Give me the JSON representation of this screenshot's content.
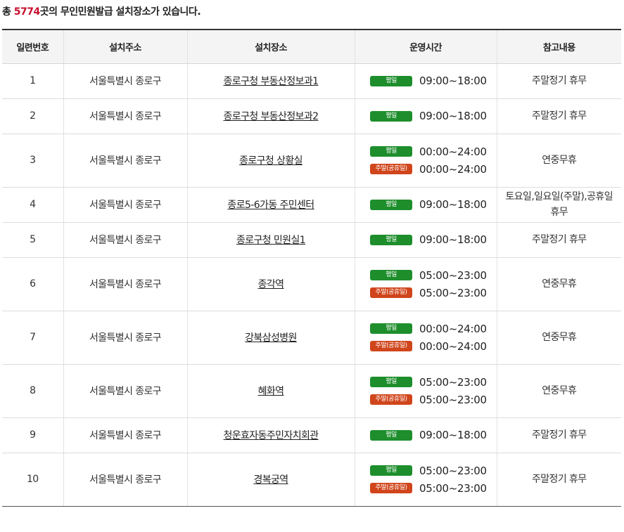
{
  "summary": {
    "prefix": "총 ",
    "count": "5774",
    "suffix": "곳의 무인민원발급 설치장소가 있습니다."
  },
  "table": {
    "headers": [
      "일련번호",
      "설치주소",
      "설치장소",
      "운영시간",
      "참고내용"
    ],
    "badges": {
      "weekday": "평일",
      "weekend": "주말(공휴일)"
    },
    "colors": {
      "weekday": "#1e8e2c",
      "weekend": "#d0451b",
      "count": "#c8102e"
    },
    "rows": [
      {
        "no": "1",
        "address": "서울특별시 종로구",
        "place": "종로구청 부동산정보과1",
        "weekday": "09:00~18:00",
        "weekend": null,
        "note": "주말정기 휴무"
      },
      {
        "no": "2",
        "address": "서울특별시 종로구",
        "place": "종로구청 부동산정보과2",
        "weekday": "09:00~18:00",
        "weekend": null,
        "note": "주말정기 휴무"
      },
      {
        "no": "3",
        "address": "서울특별시 종로구",
        "place": "종로구청 상황실",
        "weekday": "00:00~24:00",
        "weekend": "00:00~24:00",
        "note": "연중무휴"
      },
      {
        "no": "4",
        "address": "서울특별시 종로구",
        "place": "종로5-6가동 주민센터",
        "weekday": "09:00~18:00",
        "weekend": null,
        "note": "토요일,일요일(주말),공휴일 휴무"
      },
      {
        "no": "5",
        "address": "서울특별시 종로구",
        "place": "종로구청 민원실1",
        "weekday": "09:00~18:00",
        "weekend": null,
        "note": "주말정기 휴무"
      },
      {
        "no": "6",
        "address": "서울특별시 종로구",
        "place": "종각역",
        "weekday": "05:00~23:00",
        "weekend": "05:00~23:00",
        "note": "연중무휴"
      },
      {
        "no": "7",
        "address": "서울특별시 종로구",
        "place": "강북삼성병원",
        "weekday": "00:00~24:00",
        "weekend": "00:00~24:00",
        "note": "연중무휴"
      },
      {
        "no": "8",
        "address": "서울특별시 종로구",
        "place": "혜화역",
        "weekday": "05:00~23:00",
        "weekend": "05:00~23:00",
        "note": "연중무휴"
      },
      {
        "no": "9",
        "address": "서울특별시 종로구",
        "place": "청운효자동주민자치회관",
        "weekday": "09:00~18:00",
        "weekend": null,
        "note": "주말정기 휴무"
      },
      {
        "no": "10",
        "address": "서울특별시 종로구",
        "place": "경복궁역",
        "weekday": "05:00~23:00",
        "weekend": "05:00~23:00",
        "note": "주말정기 휴무"
      }
    ]
  }
}
